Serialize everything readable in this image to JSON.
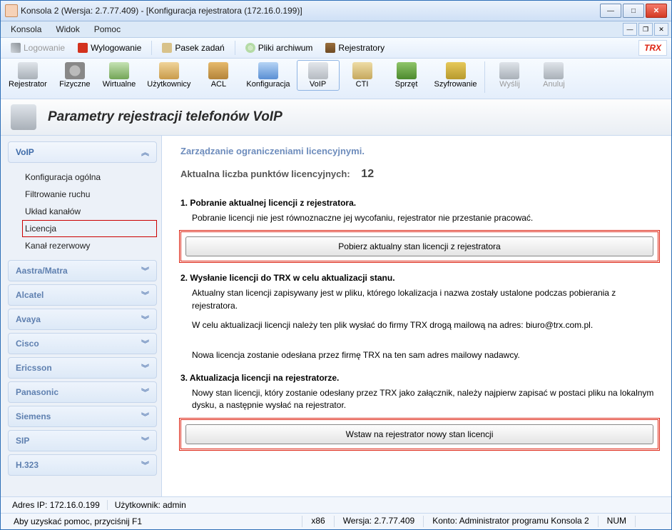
{
  "window": {
    "title": "Konsola 2 (Wersja:  2.7.77.409) - [Konfiguracja rejestratora (172.16.0.199)]"
  },
  "menu": {
    "konsola": "Konsola",
    "widok": "Widok",
    "pomoc": "Pomoc"
  },
  "tb1": {
    "logowanie": "Logowanie",
    "wylogowanie": "Wylogowanie",
    "pasek": "Pasek zadań",
    "pliki": "Pliki archiwum",
    "rejestratory": "Rejestratory",
    "logo": "TRX"
  },
  "tb2": {
    "rejestrator": "Rejestrator",
    "fizyczne": "Fizyczne",
    "wirtualne": "Wirtualne",
    "uzytkownicy": "Użytkownicy",
    "acl": "ACL",
    "konfiguracja": "Konfiguracja",
    "voip": "VoIP",
    "cti": "CTI",
    "sprzet": "Sprzęt",
    "szyfrowanie": "Szyfrowanie",
    "wyslij": "Wyślij",
    "anuluj": "Anuluj"
  },
  "header": {
    "title": "Parametry rejestracji telefonów VoIP"
  },
  "sidebar": {
    "voip": "VoIP",
    "items": [
      "Konfiguracja ogólna",
      "Filtrowanie ruchu",
      "Układ kanałów",
      "Licencja",
      "Kanał rezerwowy"
    ],
    "groups": [
      "Aastra/Matra",
      "Alcatel",
      "Avaya",
      "Cisco",
      "Ericsson",
      "Panasonic",
      "Siemens",
      "SIP",
      "H.323"
    ]
  },
  "main": {
    "subtitle": "Zarządzanie ograniczeniami licencyjnymi.",
    "lic_label": "Aktualna liczba punktów licencyjnych:",
    "lic_value": "12",
    "s1_title": "1. Pobranie aktualnej licencji z rejestratora.",
    "s1_p": "Pobranie licencji nie jest równoznaczne jej wycofaniu, rejestrator nie przestanie pracować.",
    "s1_btn": "Pobierz aktualny stan licencji z rejestratora",
    "s2_title": "2. Wysłanie licencji do TRX w celu aktualizacji stanu.",
    "s2_p1": "Aktualny stan licencji zapisywany jest w pliku, którego lokalizacja i nazwa zostały ustalone podczas pobierania z rejestratora.",
    "s2_p2": "W celu aktualizacji licencji należy ten plik wysłać do firmy TRX drogą mailową na adres: biuro@trx.com.pl.",
    "s2_p3": "Nowa licencja zostanie odesłana przez firmę TRX na ten sam adres mailowy nadawcy.",
    "s3_title": "3. Aktualizacja licencji na rejestratorze.",
    "s3_p": "Nowy stan licencji, który zostanie odesłany przez TRX jako załącznik, należy najpierw zapisać w postaci pliku na lokalnym dysku, a następnie wysłać na rejestrator.",
    "s3_btn": "Wstaw na rejestrator nowy stan licencji"
  },
  "infobar": {
    "ip_label": "Adres IP: ",
    "ip": "172.16.0.199",
    "user_label": "Użytkownik: ",
    "user": "admin"
  },
  "status": {
    "help": "Aby uzyskać pomoc, przyciśnij F1",
    "arch": "x86",
    "ver_label": "Wersja: ",
    "ver": "2.7.77.409",
    "konto_label": "Konto: ",
    "konto": "Administrator programu Konsola 2",
    "num": "NUM"
  }
}
